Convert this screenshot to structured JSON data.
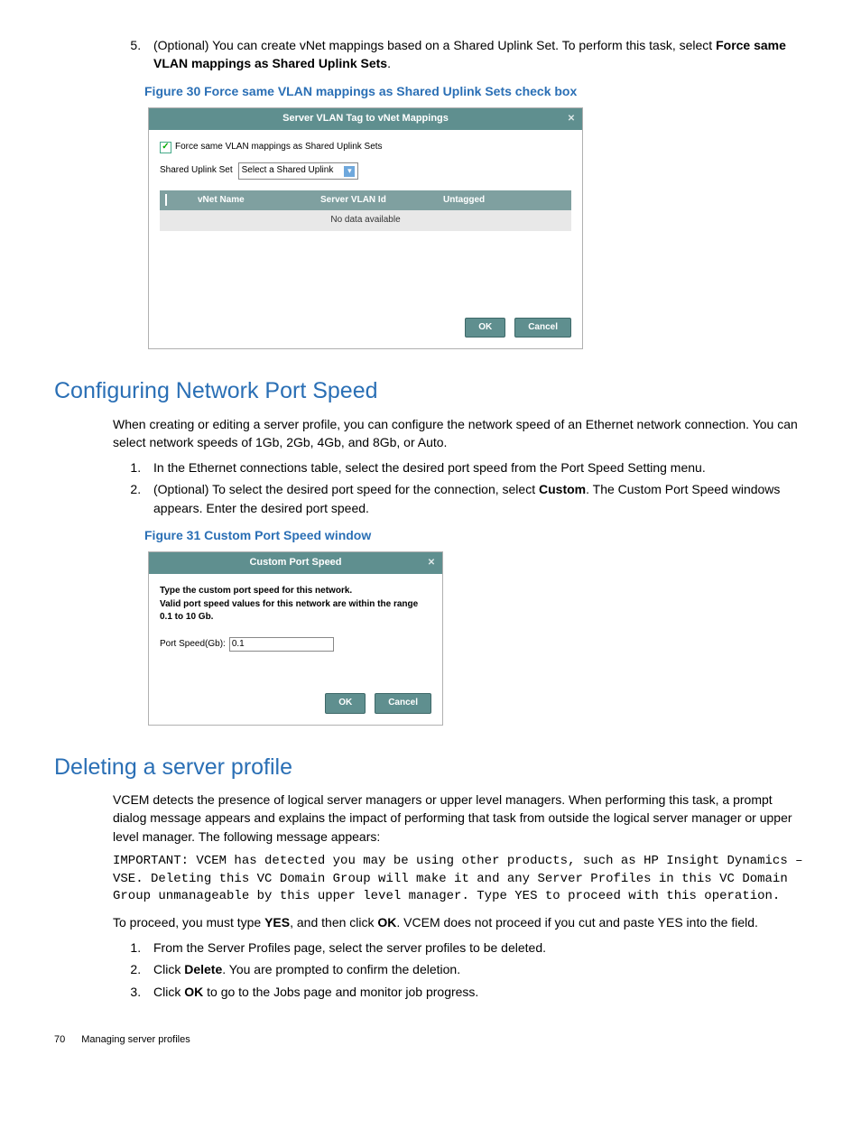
{
  "step5": {
    "num": "5.",
    "text_a": "(Optional) You can create vNet mappings based on a Shared Uplink Set. To perform this task, select ",
    "bold": "Force same VLAN mappings as Shared Uplink Sets",
    "text_b": "."
  },
  "fig30": {
    "caption": "Figure 30 Force same VLAN mappings as Shared Uplink Sets check box",
    "title": "Server VLAN Tag to vNet Mappings",
    "chk_label": "Force same VLAN mappings as Shared Uplink Sets",
    "shared_label": "Shared Uplink Set",
    "dropdown_text": "Select a Shared Uplink",
    "col_vnet": "vNet Name",
    "col_vlan": "Server VLAN Id",
    "col_untagged": "Untagged",
    "no_data": "No data available",
    "ok": "OK",
    "cancel": "Cancel"
  },
  "section_cfg": {
    "heading": "Configuring Network Port Speed",
    "p1": "When creating or editing a server profile, you can configure the network speed of an Ethernet network connection. You can select network speeds of 1Gb, 2Gb, 4Gb, and 8Gb, or Auto.",
    "li1": "In the Ethernet connections table, select the desired port speed from the Port Speed Setting menu.",
    "li2_a": "(Optional) To select the desired port speed for the connection, select ",
    "li2_bold": "Custom",
    "li2_b": ". The Custom Port Speed windows appears. Enter the desired port speed."
  },
  "fig31": {
    "caption": "Figure 31 Custom Port Speed window",
    "title": "Custom Port Speed",
    "body_l1": "Type the custom port speed for this network.",
    "body_l2": "Valid port speed values for this network are within the range 0.1 to 10 Gb.",
    "field_label": "Port Speed(Gb):",
    "field_value": "0.1",
    "ok": "OK",
    "cancel": "Cancel"
  },
  "section_del": {
    "heading": "Deleting a server profile",
    "p1": "VCEM detects the presence of logical server managers or upper level managers. When performing this task, a prompt dialog message appears and explains the impact of performing that task from outside the logical server manager or upper level manager. The following message appears:",
    "important": "IMPORTANT: VCEM has detected you may be using other products, such as HP Insight Dynamics – VSE. Deleting this VC Domain Group will make it and any Server Profiles in this VC Domain Group unmanageable by this upper level manager. Type YES to proceed with this operation.",
    "p2_a": "To proceed, you must type ",
    "p2_b1": "YES",
    "p2_b": ", and then click ",
    "p2_b2": "OK",
    "p2_c": ". VCEM does not proceed if you cut and paste YES into the field.",
    "li1": "From the Server Profiles page, select the server profiles to be deleted.",
    "li2_a": "Click ",
    "li2_bold": "Delete",
    "li2_b": ". You are prompted to confirm the deletion.",
    "li3_a": "Click ",
    "li3_bold": "OK",
    "li3_b": " to go to the Jobs page and monitor job progress."
  },
  "footer": {
    "page": "70",
    "title": "Managing server profiles"
  }
}
